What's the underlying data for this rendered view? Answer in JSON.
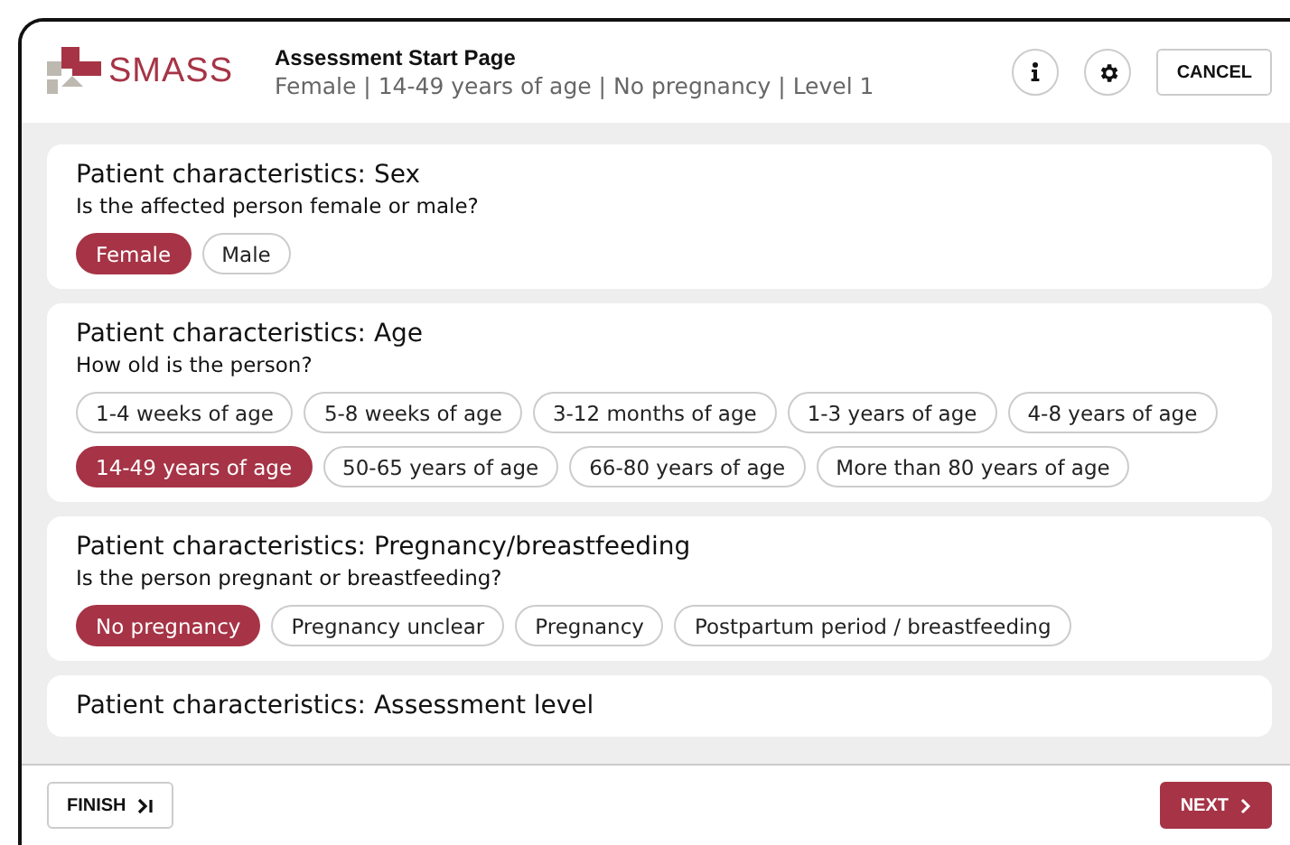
{
  "header": {
    "logo_text": "SMASS",
    "title": "Assessment Start Page",
    "subtitle": "Female | 14-49 years of age | No pregnancy | Level 1",
    "cancel": "CANCEL"
  },
  "sections": [
    {
      "title": "Patient characteristics: Sex",
      "question": "Is the affected person female or male?",
      "options": [
        {
          "label": "Female",
          "selected": true
        },
        {
          "label": "Male",
          "selected": false
        }
      ]
    },
    {
      "title": "Patient characteristics: Age",
      "question": "How old is the person?",
      "options": [
        {
          "label": "1-4 weeks of age",
          "selected": false
        },
        {
          "label": "5-8 weeks of age",
          "selected": false
        },
        {
          "label": "3-12 months of age",
          "selected": false
        },
        {
          "label": "1-3 years of age",
          "selected": false
        },
        {
          "label": "4-8 years of age",
          "selected": false
        },
        {
          "label": "14-49 years of age",
          "selected": true
        },
        {
          "label": "50-65 years of age",
          "selected": false
        },
        {
          "label": "66-80 years of age",
          "selected": false
        },
        {
          "label": "More than 80 years of age",
          "selected": false
        }
      ]
    },
    {
      "title": "Patient characteristics: Pregnancy/breastfeeding",
      "question": "Is the person pregnant or breastfeeding?",
      "options": [
        {
          "label": "No pregnancy",
          "selected": true
        },
        {
          "label": "Pregnancy unclear",
          "selected": false
        },
        {
          "label": "Pregnancy",
          "selected": false
        },
        {
          "label": "Postpartum period / breastfeeding",
          "selected": false
        }
      ]
    },
    {
      "title": "Patient characteristics: Assessment level"
    }
  ],
  "footer": {
    "finish": "FINISH",
    "next": "NEXT"
  }
}
